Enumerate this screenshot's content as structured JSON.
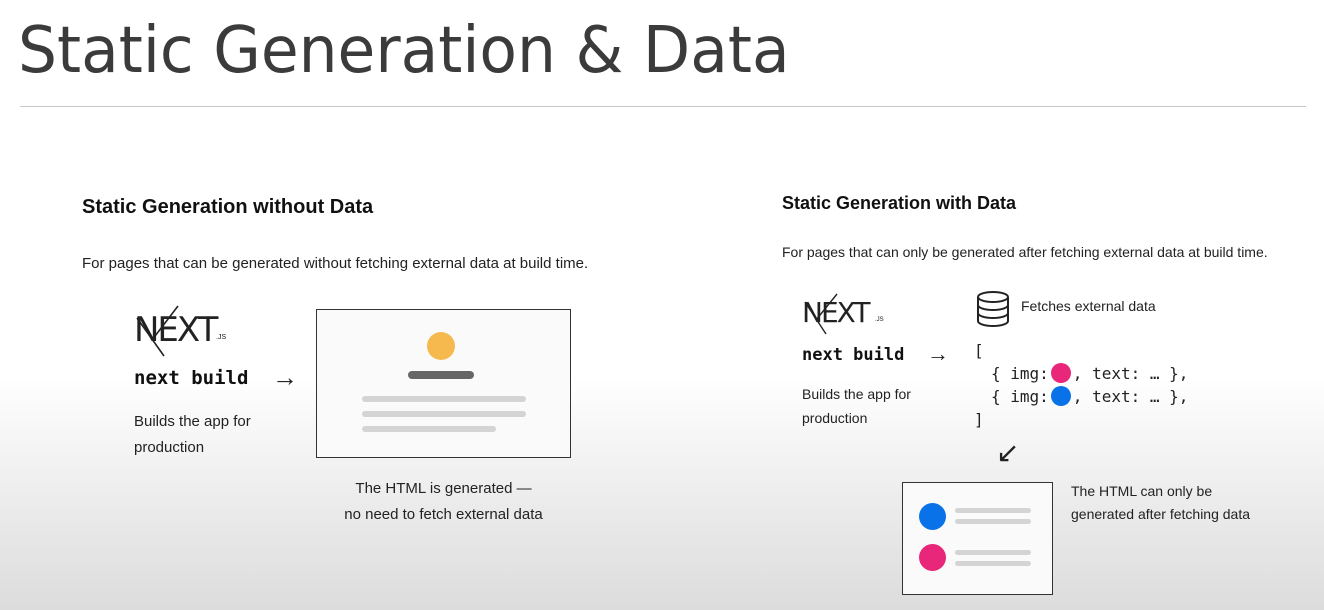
{
  "slide": {
    "title": "Static Generation & Data"
  },
  "left": {
    "heading": "Static Generation without Data",
    "description": "For pages that can be generated without fetching external data at build time.",
    "logo_text": "NEXT",
    "logo_suffix": ".JS",
    "command": "next build",
    "arrow": "→",
    "caption_line1": "Builds the app for",
    "caption_line2": "production",
    "html_caption_line1": "The HTML is generated —",
    "html_caption_line2": "no need to fetch external data"
  },
  "right": {
    "heading": "Static Generation with Data",
    "description": "For pages that can only be generated after fetching external data at build time.",
    "logo_text": "NEXT",
    "logo_suffix": ".JS",
    "command": "next build",
    "arrow": "→",
    "caption_line1": "Builds the app for",
    "caption_line2": "production",
    "fetch_label": "Fetches external data",
    "code_open": "[",
    "code_item_prefix": "{ img:",
    "code_item_suffix": ", text: … },",
    "code_close": "]",
    "diag_arrow": "↙",
    "html_caption_line1": "The HTML can only be",
    "html_caption_line2": "generated after fetching data"
  },
  "colors": {
    "yellow": "#f5b94e",
    "pink": "#e8267a",
    "blue": "#0a72e8"
  },
  "icons": {
    "database": "database-icon"
  }
}
